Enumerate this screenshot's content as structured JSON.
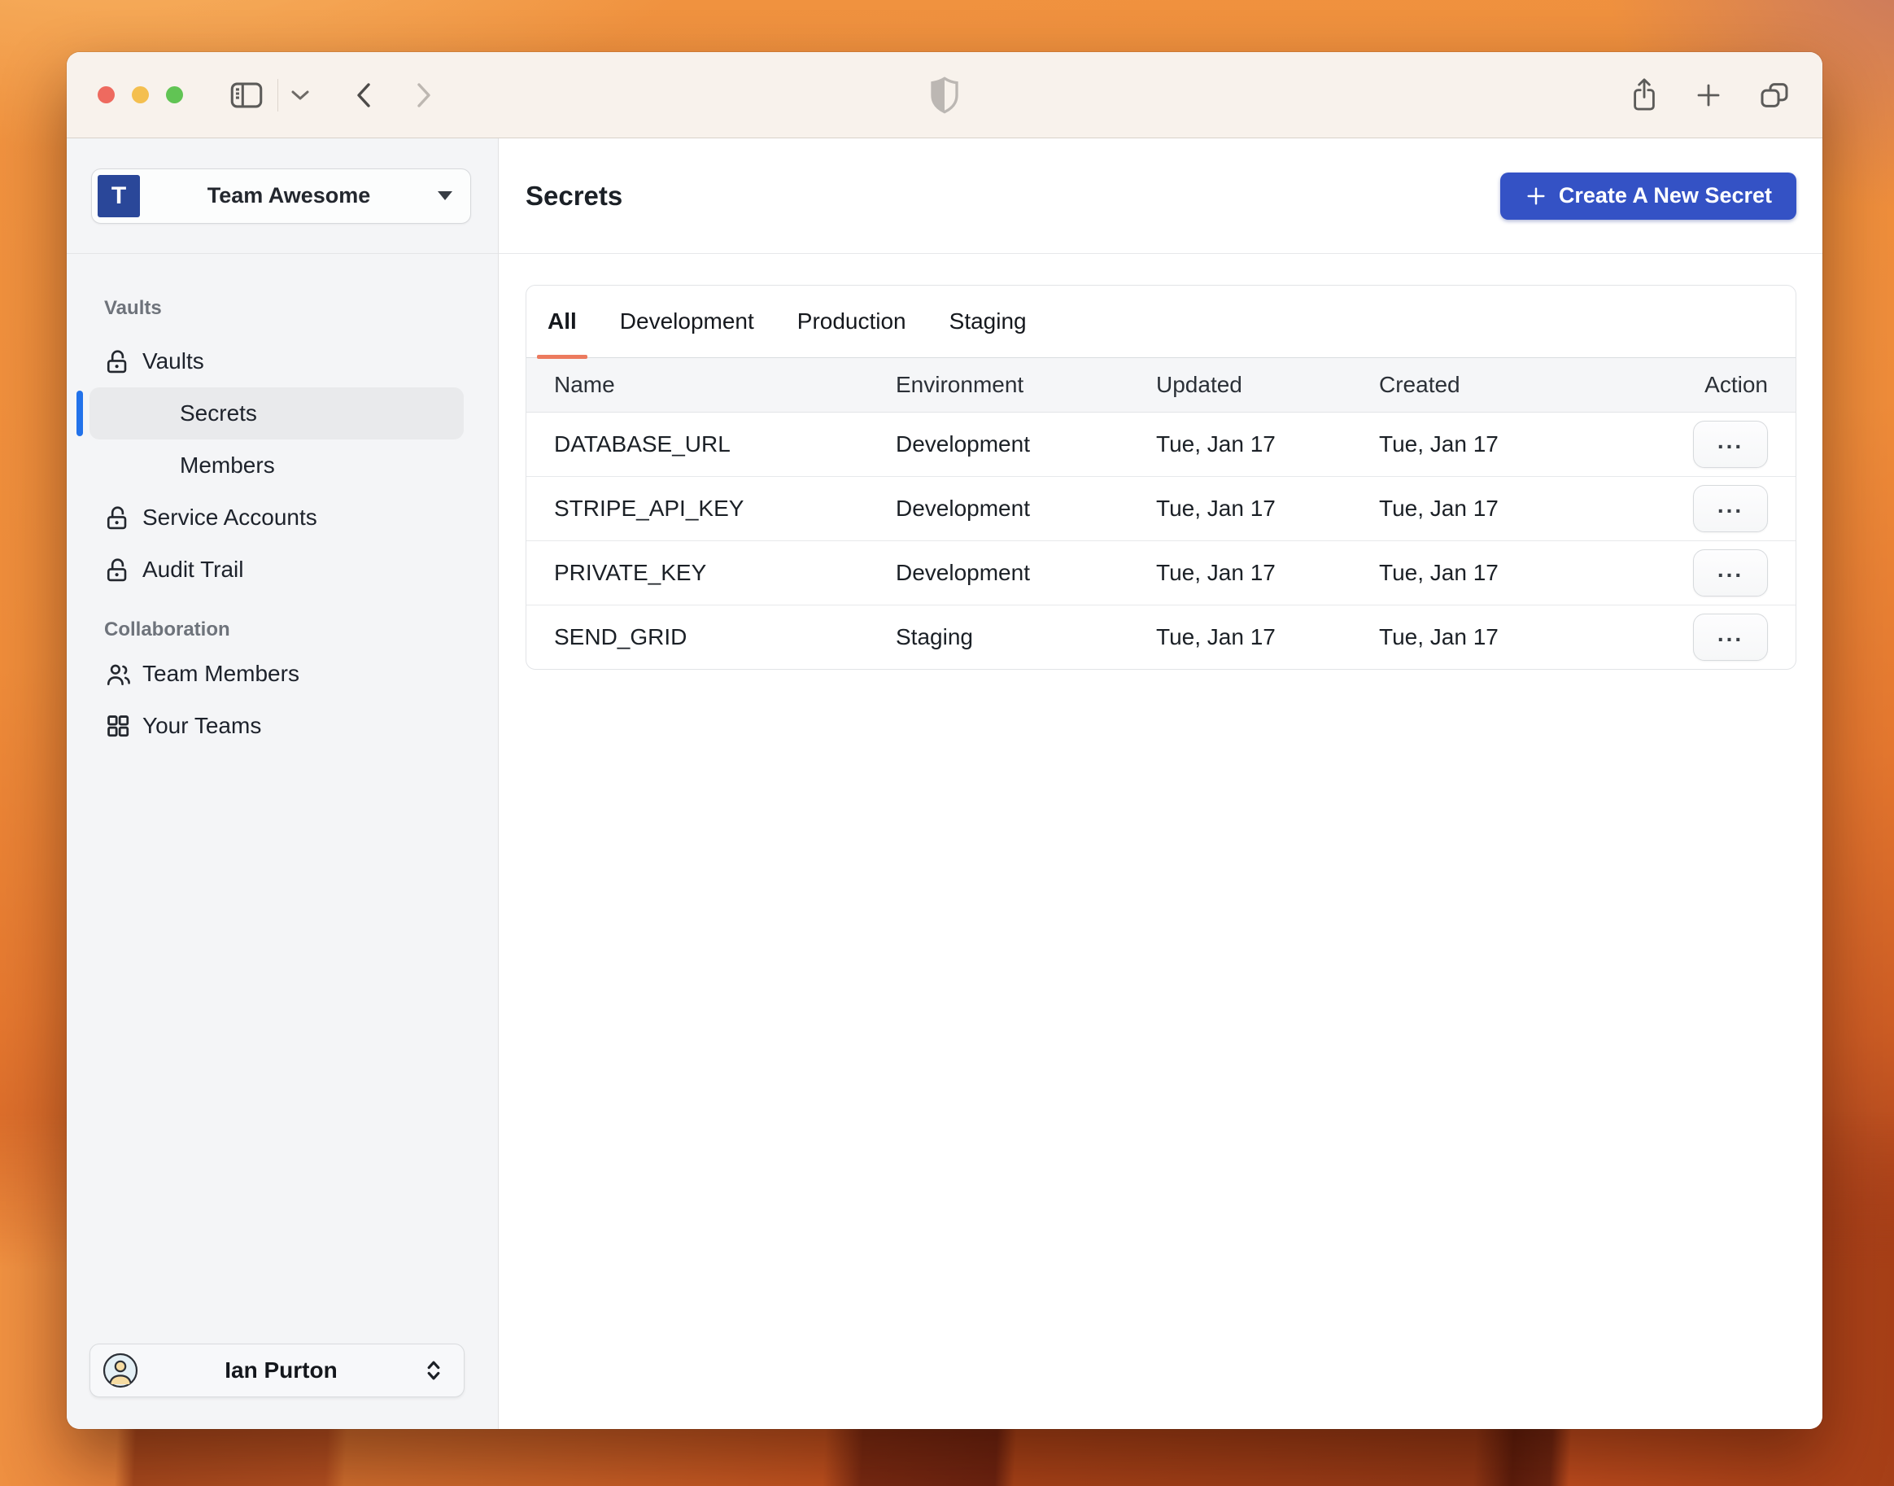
{
  "titlebar": {
    "icons": [
      "sidebar-toggle",
      "chevron-down",
      "back",
      "forward",
      "shield",
      "share",
      "new-tab",
      "tab-overview"
    ],
    "traffic_colors": {
      "close": "#ee6a5f",
      "minimize": "#f4bf4f",
      "zoom": "#61c454"
    }
  },
  "sidebar": {
    "team": {
      "initial": "T",
      "name": "Team Awesome",
      "avatar_color": "#2a4799"
    },
    "sections": [
      {
        "label": "Vaults",
        "items": [
          {
            "label": "Vaults",
            "icon": "unlock-icon"
          },
          {
            "label": "Secrets",
            "selected": true
          },
          {
            "label": "Members"
          },
          {
            "label": "Service Accounts",
            "icon": "unlock-icon"
          },
          {
            "label": "Audit Trail",
            "icon": "unlock-icon"
          }
        ]
      },
      {
        "label": "Collaboration",
        "items": [
          {
            "label": "Team Members",
            "icon": "people-icon"
          },
          {
            "label": "Your Teams",
            "icon": "grid-icon"
          }
        ]
      }
    ],
    "user": {
      "name": "Ian Purton",
      "icon": "user-circle-icon"
    }
  },
  "main": {
    "title": "Secrets",
    "create_button": "Create A New Secret",
    "tabs": [
      "All",
      "Development",
      "Production",
      "Staging"
    ],
    "active_tab": "All",
    "table": {
      "columns": [
        "Name",
        "Environment",
        "Updated",
        "Created",
        "Action"
      ],
      "action_label": "...",
      "rows": [
        {
          "name": "DATABASE_URL",
          "environment": "Development",
          "updated": "Tue, Jan 17",
          "created": "Tue, Jan 17"
        },
        {
          "name": "STRIPE_API_KEY",
          "environment": "Development",
          "updated": "Tue, Jan 17",
          "created": "Tue, Jan 17"
        },
        {
          "name": "PRIVATE_KEY",
          "environment": "Development",
          "updated": "Tue, Jan 17",
          "created": "Tue, Jan 17"
        },
        {
          "name": "SEND_GRID",
          "environment": "Staging",
          "updated": "Tue, Jan 17",
          "created": "Tue, Jan 17"
        }
      ]
    }
  },
  "colors": {
    "accent_blue": "#3452c5",
    "selected_bar_blue": "#2272ea",
    "tab_underline": "#ec7a5e",
    "sidebar_bg": "#f4f5f7",
    "titlebar_bg": "#f8f2ec"
  }
}
